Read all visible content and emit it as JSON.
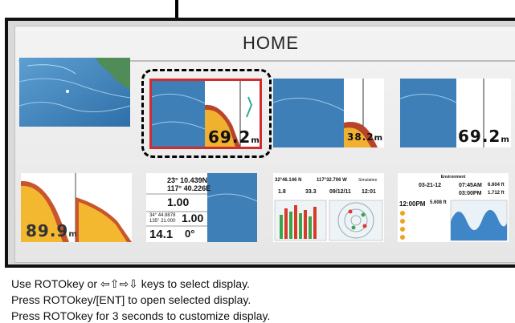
{
  "home": {
    "title": "HOME"
  },
  "thumbnails": {
    "t2": {
      "depth": "69.2",
      "unit": "m"
    },
    "t3": {
      "depth": "38.2",
      "unit": "m"
    },
    "t4": {
      "depth": "69.2",
      "unit": "m"
    },
    "t5": {
      "depth": "89.9",
      "unit": "m"
    },
    "t6": {
      "lat": "23° 10.439N",
      "lon": "117° 40.226E",
      "val1": "1.00",
      "lat2": "34° 44.8878",
      "lon2": "135° 21.000",
      "val2": "1.00",
      "speed": "14.1",
      "heading": "0°"
    },
    "t7": {
      "lat": "32°46.146 N",
      "lon": "117°32.706 W",
      "mode": "Simulation",
      "v1": "1.8",
      "v2": "33.3",
      "date": "09/12/11",
      "time": "12:01"
    },
    "t8": {
      "header": "Environment",
      "date": "03-21-12",
      "time1": "07:45AM",
      "ft1": "6.604 ft",
      "time2": "03:00PM",
      "ft2": "1.712 ft",
      "now": "12:00PM",
      "now_ft": "5.608 ft"
    }
  },
  "instructions": [
    "Use ROTOkey or ⇦⇧⇨⇩ keys to select display.",
    "Press ROTOkey/[ENT] to open selected display.",
    "Press ROTOkey for 3 seconds to customize display."
  ],
  "colors": {
    "selection": "#d22c2c",
    "sea": "#3f7fb8",
    "land": "#5a8f5a"
  }
}
